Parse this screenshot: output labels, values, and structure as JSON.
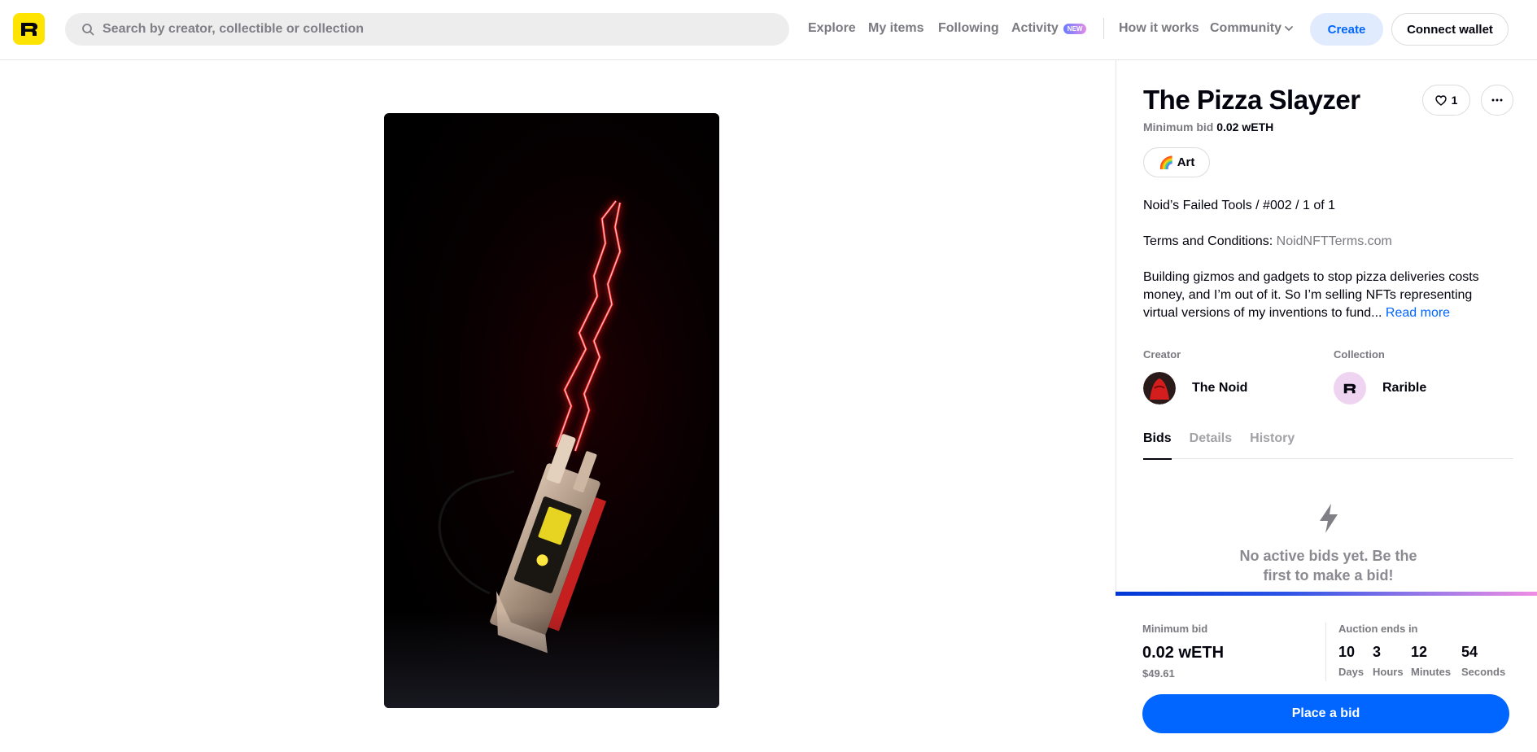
{
  "header": {
    "search_placeholder": "Search by creator, collectible or collection",
    "nav": [
      "Explore",
      "My items",
      "Following",
      "Activity"
    ],
    "activity_badge": "NEW",
    "how_it_works": "How it works",
    "community": "Community",
    "create": "Create",
    "connect_wallet": "Connect wallet"
  },
  "item": {
    "title": "The Pizza Slayzer",
    "min_bid_label": "Minimum bid",
    "min_bid_value": "0.02 wETH",
    "likes": "1",
    "category": "Art",
    "category_emoji": "🌈",
    "series_line": "Noid’s Failed Tools / #002 / 1 of 1",
    "terms_label": "Terms and Conditions:",
    "terms_link": "NoidNFTTerms.com",
    "description": "Building gizmos and gadgets to stop pizza deliveries costs money, and I’m out of it. So I’m selling NFTs representing virtual versions of my inventions to fund...",
    "read_more": "Read more",
    "creator_label": "Creator",
    "creator_name": "The Noid",
    "collection_label": "Collection",
    "collection_name": "Rarible"
  },
  "tabs": [
    "Bids",
    "Details",
    "History"
  ],
  "bids_empty": {
    "line1": "No active bids yet. Be the",
    "line2": "first to make a bid!"
  },
  "bid_bar": {
    "min_bid_label": "Minimum bid",
    "min_bid_value": "0.02 wETH",
    "min_bid_usd": "$49.61",
    "auction_label": "Auction ends in",
    "countdown": [
      {
        "num": "10",
        "unit": "Days"
      },
      {
        "num": "3",
        "unit": "Hours"
      },
      {
        "num": "12",
        "unit": "Minutes"
      },
      {
        "num": "54",
        "unit": "Seconds"
      }
    ],
    "place_bid": "Place a bid"
  },
  "colors": {
    "brand_yellow": "#fee400",
    "accent_blue": "#0066ff",
    "create_bg": "#e0ebfe"
  }
}
